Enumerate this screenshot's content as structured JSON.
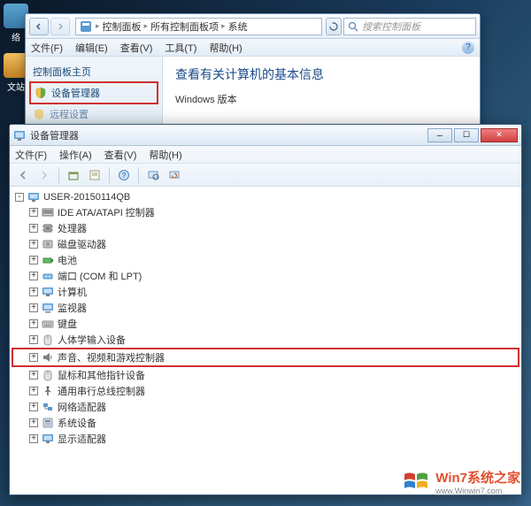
{
  "desktop": {
    "icons": [
      {
        "label": "络"
      },
      {
        "label": "文站"
      }
    ]
  },
  "control_panel": {
    "breadcrumb": [
      "控制面板",
      "所有控制面板项",
      "系统"
    ],
    "refresh_label": "",
    "search_placeholder": "搜索控制面板",
    "menu": [
      "文件(F)",
      "编辑(E)",
      "查看(V)",
      "工具(T)",
      "帮助(H)"
    ],
    "sidebar": {
      "items": [
        {
          "label": "控制面板主页"
        },
        {
          "label": "设备管理器"
        },
        {
          "label": "远程设置"
        }
      ]
    },
    "content": {
      "heading": "查看有关计算机的基本信息",
      "section_label": "Windows 版本"
    }
  },
  "device_manager": {
    "title": "设备管理器",
    "menu": [
      "文件(F)",
      "操作(A)",
      "查看(V)",
      "帮助(H)"
    ],
    "toolbar_icons": [
      "back",
      "forward",
      "up",
      "properties",
      "help",
      "refresh",
      "scan"
    ],
    "tree": {
      "root": "USER-20150114QB",
      "nodes": [
        {
          "label": "IDE ATA/ATAPI 控制器",
          "icon": "ide"
        },
        {
          "label": "处理器",
          "icon": "cpu"
        },
        {
          "label": "磁盘驱动器",
          "icon": "disk"
        },
        {
          "label": "电池",
          "icon": "battery"
        },
        {
          "label": "端口 (COM 和 LPT)",
          "icon": "port"
        },
        {
          "label": "计算机",
          "icon": "computer"
        },
        {
          "label": "监视器",
          "icon": "monitor"
        },
        {
          "label": "键盘",
          "icon": "keyboard"
        },
        {
          "label": "人体学输入设备",
          "icon": "hid"
        },
        {
          "label": "声音、视频和游戏控制器",
          "icon": "sound",
          "highlighted": true
        },
        {
          "label": "鼠标和其他指针设备",
          "icon": "mouse"
        },
        {
          "label": "通用串行总线控制器",
          "icon": "usb"
        },
        {
          "label": "网络适配器",
          "icon": "network"
        },
        {
          "label": "系统设备",
          "icon": "system"
        },
        {
          "label": "显示适配器",
          "icon": "display"
        }
      ]
    }
  },
  "watermark": {
    "title": "Win7系统之家",
    "url": "www.Winwin7.com"
  }
}
